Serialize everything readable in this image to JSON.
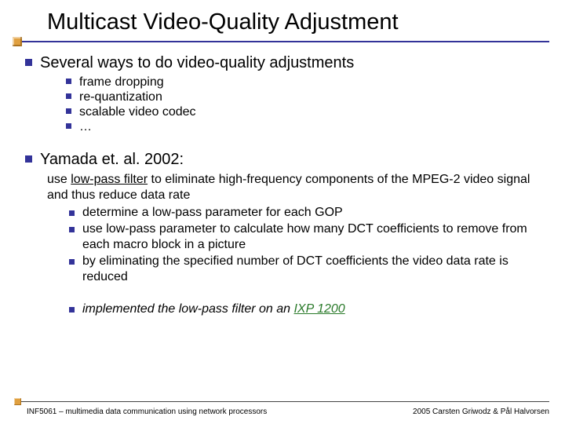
{
  "title": "Multicast Video-Quality Adjustment",
  "section1": {
    "heading": "Several ways to do video-quality adjustments",
    "items": [
      "frame dropping",
      "re-quantization",
      "scalable video codec",
      "…"
    ]
  },
  "section2": {
    "heading": "Yamada et. al. 2002:",
    "intro_pre": "use ",
    "intro_lowpass": "low-pass filter",
    "intro_post": " to eliminate high-frequency components of the MPEG-2 video signal and thus reduce data rate",
    "subitems": [
      "determine a low-pass parameter for each GOP",
      "use low-pass parameter to calculate how many DCT coefficients to remove from each macro block in a picture",
      "by eliminating the specified number of DCT coefficients the video data rate is reduced"
    ],
    "impl_pre": "implemented the low-pass filter on an ",
    "impl_ixp": "IXP 1200"
  },
  "footer": {
    "left": "INF5061 – multimedia data communication using network processors",
    "right": "2005 Carsten Griwodz & Pål Halvorsen"
  }
}
